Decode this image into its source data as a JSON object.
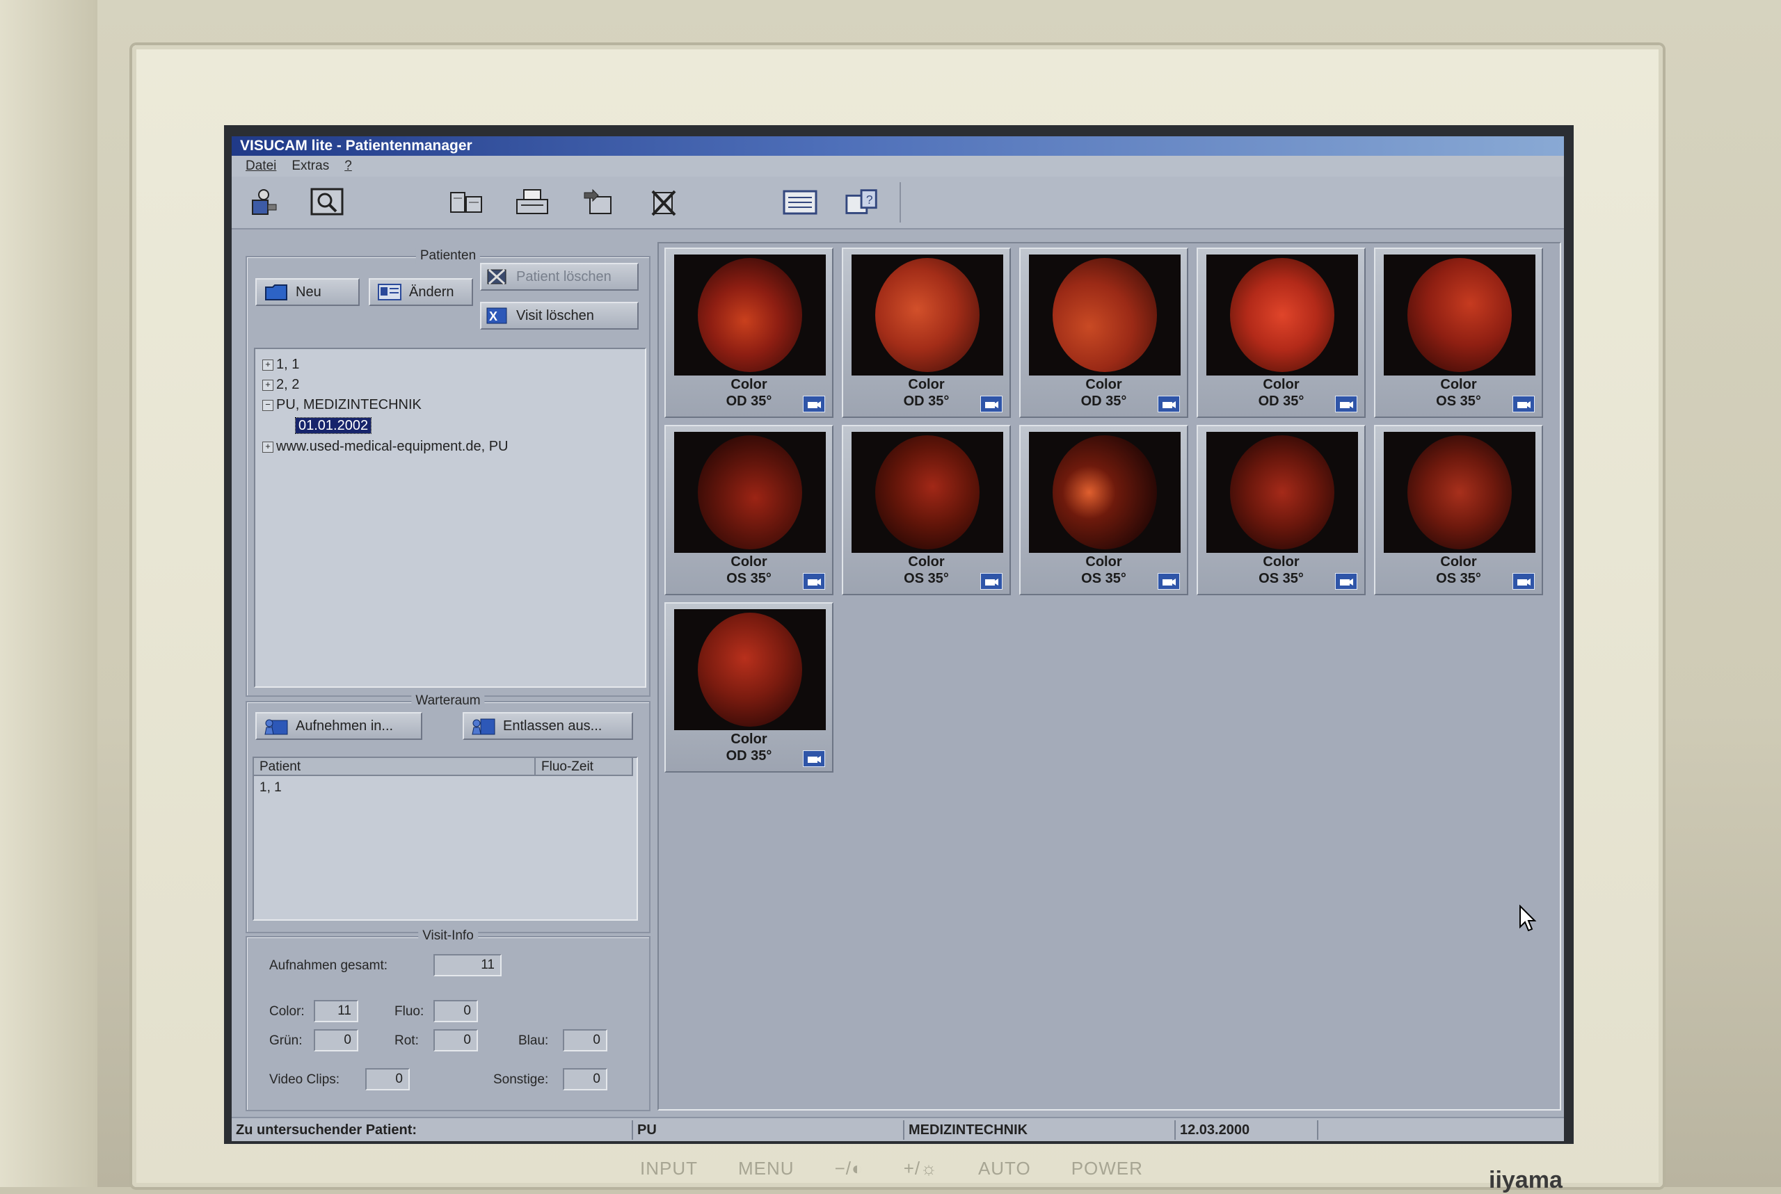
{
  "window": {
    "title": "VISUCAM lite - Patientenmanager"
  },
  "menu": {
    "items": [
      "Datei",
      "Extras",
      "?"
    ]
  },
  "toolbar": {
    "buttons": [
      {
        "name": "capture-icon"
      },
      {
        "name": "view-icon"
      },
      {
        "name": "archive-icon"
      },
      {
        "name": "print-icon"
      },
      {
        "name": "export-icon"
      },
      {
        "name": "delete-icon"
      },
      {
        "name": "list-icon"
      },
      {
        "name": "info-icon"
      }
    ]
  },
  "patients": {
    "title": "Patienten",
    "new_label": "Neu",
    "edit_label": "Ändern",
    "delete_patient_label": "Patient löschen",
    "delete_visit_label": "Visit löschen",
    "tree": [
      {
        "label": "1, 1",
        "expander": "+"
      },
      {
        "label": "2, 2",
        "expander": "+"
      },
      {
        "label": "PU, MEDIZINTECHNIK",
        "expander": "−"
      },
      {
        "label": "01.01.2002",
        "selected": true
      },
      {
        "label": "www.used-medical-equipment.de, PU",
        "expander": "+"
      }
    ]
  },
  "waiting_room": {
    "title": "Warteraum",
    "admit_label": "Aufnehmen in...",
    "discharge_label": "Entlassen aus...",
    "col_patient": "Patient",
    "col_fluo": "Fluo-Zeit",
    "rows": [
      "1, 1"
    ]
  },
  "visit_info": {
    "title": "Visit-Info",
    "total_label": "Aufnahmen gesamt:",
    "total_value": "11",
    "color_label": "Color:",
    "color_value": "11",
    "fluo_label": "Fluo:",
    "fluo_value": "0",
    "green_label": "Grün:",
    "green_value": "0",
    "red_label": "Rot:",
    "red_value": "0",
    "blue_label": "Blau:",
    "blue_value": "0",
    "video_label": "Video Clips:",
    "video_value": "0",
    "other_label": "Sonstige:",
    "other_value": "0"
  },
  "thumbnails": [
    {
      "type": "Color",
      "eye": "OD 35°"
    },
    {
      "type": "Color",
      "eye": "OD 35°"
    },
    {
      "type": "Color",
      "eye": "OD 35°"
    },
    {
      "type": "Color",
      "eye": "OD 35°"
    },
    {
      "type": "Color",
      "eye": "OS 35°"
    },
    {
      "type": "Color",
      "eye": "OS 35°"
    },
    {
      "type": "Color",
      "eye": "OS 35°"
    },
    {
      "type": "Color",
      "eye": "OS 35°"
    },
    {
      "type": "Color",
      "eye": "OS 35°"
    },
    {
      "type": "Color",
      "eye": "OS 35°"
    },
    {
      "type": "Color",
      "eye": "OD 35°"
    }
  ],
  "status": {
    "label": "Zu untersuchender Patient:",
    "last_name": "PU",
    "first_name": "MEDIZINTECHNIK",
    "date": "12.03.2000"
  },
  "monitor": {
    "buttons": [
      "INPUT",
      "MENU",
      "−/◐",
      "+/☼",
      "AUTO",
      "POWER"
    ],
    "brand": "iiyama"
  }
}
